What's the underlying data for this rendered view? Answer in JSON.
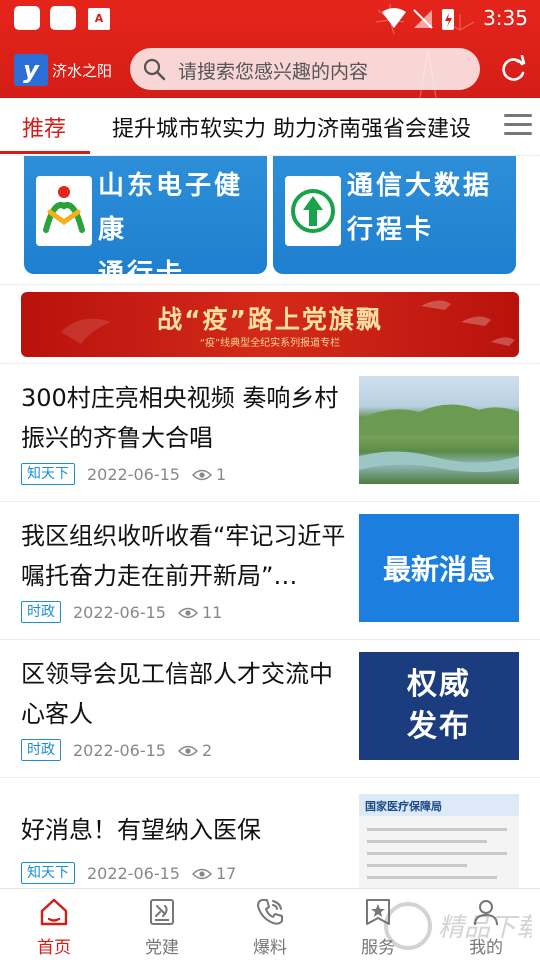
{
  "status_bar": {
    "time": "3:35",
    "notification_badge": "A"
  },
  "header": {
    "logo_text": "济水之阳",
    "logo_mark": "y",
    "search_placeholder": "请搜索您感兴趣的内容",
    "brand_color": "#d41d16"
  },
  "tabs": {
    "active_label": "推荐",
    "ticker_text": "提升城市软实力 助力济南强省会建设"
  },
  "cards": [
    {
      "title_line1": "山东电子健康",
      "title_line2": "通行卡"
    },
    {
      "title_line1": "通信大数据",
      "title_line2": "行程卡"
    }
  ],
  "banner": {
    "title": "战“疫”路上党旗飘",
    "subtitle": "“疫”线典型全纪实系列报道专栏"
  },
  "news": [
    {
      "title": "300村庄亮相央视频 奏响乡村振兴的齐鲁大合唱",
      "tag": "知天下",
      "date": "2022-06-15",
      "views": "1",
      "thumb_text": ""
    },
    {
      "title": "我区组织收听收看“牢记习近平嘱托奋力走在前开新局”…",
      "tag": "时政",
      "date": "2022-06-15",
      "views": "11",
      "thumb_text": "最新消息"
    },
    {
      "title": "区领导会见工信部人才交流中心客人",
      "tag": "时政",
      "date": "2022-06-15",
      "views": "2",
      "thumb_text_1": "权威",
      "thumb_text_2": "发布"
    },
    {
      "title": "好消息！有望纳入医保",
      "tag": "知天下",
      "date": "2022-06-15",
      "views": "17",
      "thumb_text": "国家医疗保障局"
    }
  ],
  "bottom_nav": [
    {
      "label": "首页",
      "icon": "home-icon"
    },
    {
      "label": "党建",
      "icon": "party-building-icon"
    },
    {
      "label": "爆料",
      "icon": "phone-icon"
    },
    {
      "label": "服务",
      "icon": "service-icon"
    },
    {
      "label": "我的",
      "icon": "profile-icon"
    }
  ],
  "watermark_text": "精品下载"
}
